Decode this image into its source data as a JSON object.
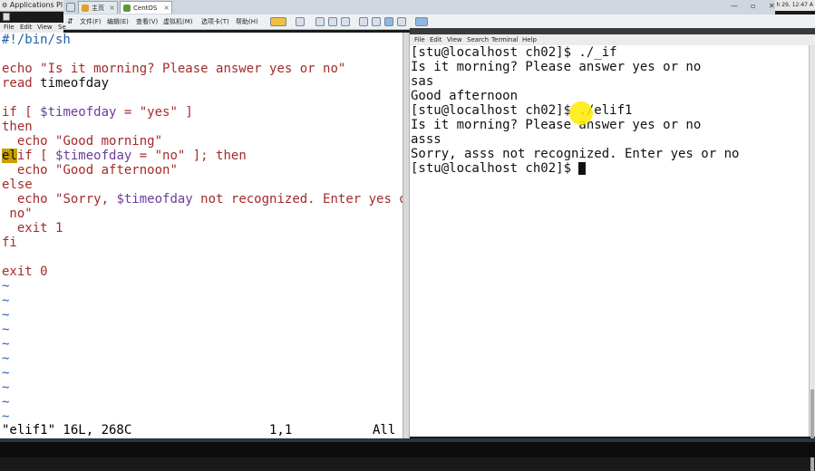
{
  "system_bar": {
    "applications": "Applications",
    "places": "Pl"
  },
  "vm_tabs": [
    {
      "label": "主页",
      "active": false
    },
    {
      "label": "CentOS",
      "active": true
    }
  ],
  "clock": "h 29, 12:47 A",
  "vm_menu": [
    "文件(F)",
    "编辑(E)",
    "查看(V)",
    "虚拟机(M)",
    "选项卡(T)",
    "帮助(H)"
  ],
  "vim_menu": [
    "File",
    "Edit",
    "View",
    "Se"
  ],
  "vim": {
    "lines": [
      [
        {
          "t": "#!/bin/sh",
          "c": "c"
        }
      ],
      [],
      [
        {
          "t": "echo ",
          "c": "k"
        },
        {
          "t": "\"Is it morning? Please answer yes or no\"",
          "c": "s"
        }
      ],
      [
        {
          "t": "read ",
          "c": "k"
        },
        {
          "t": "timeofday",
          "c": ""
        }
      ],
      [],
      [
        {
          "t": "if",
          "c": "k"
        },
        {
          "t": " [ ",
          "c": "k"
        },
        {
          "t": "$timeofday",
          "c": "v"
        },
        {
          "t": " = ",
          "c": "k"
        },
        {
          "t": "\"yes\"",
          "c": "s"
        },
        {
          "t": " ]",
          "c": "k"
        }
      ],
      [
        {
          "t": "then",
          "c": "k"
        }
      ],
      [
        {
          "t": "  echo ",
          "c": "k"
        },
        {
          "t": "\"Good morning\"",
          "c": "s"
        }
      ],
      [
        {
          "t": "el",
          "c": "cursor"
        },
        {
          "t": "if [ ",
          "c": "k"
        },
        {
          "t": "$timeofday",
          "c": "v"
        },
        {
          "t": " = ",
          "c": "k"
        },
        {
          "t": "\"no\"",
          "c": "s"
        },
        {
          "t": " ]; then",
          "c": "k"
        }
      ],
      [
        {
          "t": "  echo ",
          "c": "k"
        },
        {
          "t": "\"Good afternoon\"",
          "c": "s"
        }
      ],
      [
        {
          "t": "else",
          "c": "k"
        }
      ],
      [
        {
          "t": "  echo ",
          "c": "k"
        },
        {
          "t": "\"Sorry, ",
          "c": "s"
        },
        {
          "t": "$timeofday",
          "c": "v"
        },
        {
          "t": " not recognized. Enter yes or",
          "c": "s"
        }
      ],
      [
        {
          "t": " no\"",
          "c": "s"
        }
      ],
      [
        {
          "t": "  exit ",
          "c": "k"
        },
        {
          "t": "1",
          "c": "s"
        }
      ],
      [
        {
          "t": "fi",
          "c": "k"
        }
      ],
      [],
      [
        {
          "t": "exit ",
          "c": "k"
        },
        {
          "t": "0",
          "c": "s"
        }
      ],
      [
        {
          "t": "~",
          "c": "tilde"
        }
      ],
      [
        {
          "t": "~",
          "c": "tilde"
        }
      ],
      [
        {
          "t": "~",
          "c": "tilde"
        }
      ],
      [
        {
          "t": "~",
          "c": "tilde"
        }
      ],
      [
        {
          "t": "~",
          "c": "tilde"
        }
      ],
      [
        {
          "t": "~",
          "c": "tilde"
        }
      ],
      [
        {
          "t": "~",
          "c": "tilde"
        }
      ],
      [
        {
          "t": "~",
          "c": "tilde"
        }
      ],
      [
        {
          "t": "~",
          "c": "tilde"
        }
      ],
      [
        {
          "t": "~",
          "c": "tilde"
        }
      ]
    ],
    "status_file": "\"elif1\" 16L, 268C",
    "status_pos": "1,1",
    "status_all": "All"
  },
  "terminal_menu": [
    "File",
    "Edit",
    "View",
    "Search",
    "Terminal",
    "Help"
  ],
  "terminal": {
    "lines": [
      "[stu@localhost ch02]$ ./_if",
      "Is it morning? Please answer yes or no",
      "sas",
      "Good afternoon",
      "[stu@localhost ch02]$ ./elif1",
      "Is it morning? Please answer yes or no",
      "asss",
      "Sorry, asss not recognized. Enter yes or no",
      "[stu@localhost ch02]$ "
    ]
  },
  "colors": {
    "keyword": "#a52a2a",
    "variable": "#6a3c9c",
    "comment": "#1f5fa8",
    "highlight": "#ffeb00"
  }
}
